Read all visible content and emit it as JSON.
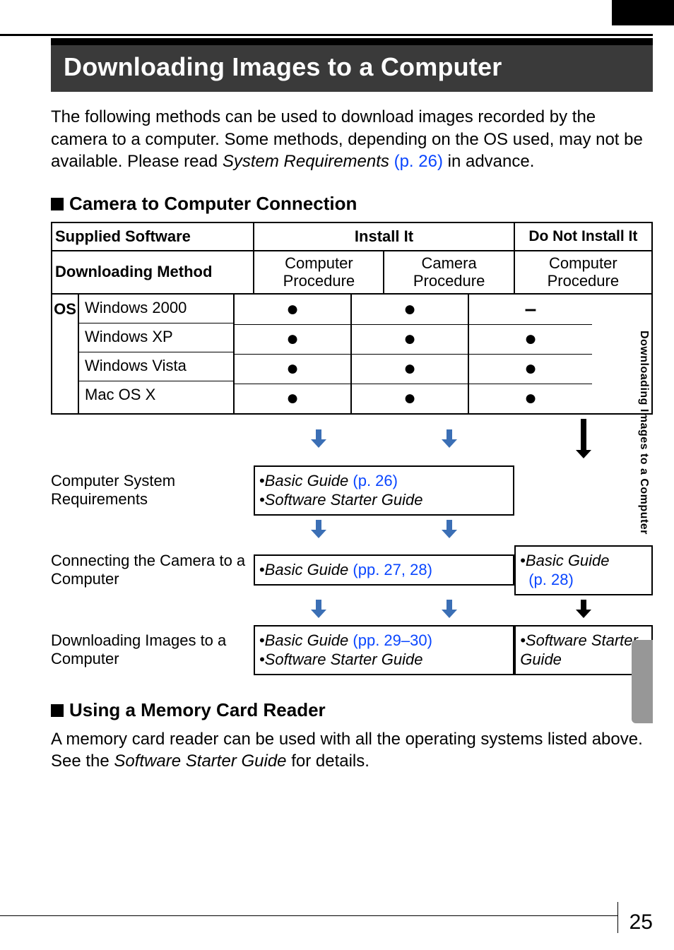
{
  "title": "Downloading Images to a Computer",
  "intro_part1": "The following methods can be used to download images recorded by the camera to a computer. Some methods, depending on the OS used, may not be available. Please read ",
  "intro_sys_req": "System Requirements",
  "intro_pref": " (p. 26)",
  "intro_part2": " in advance.",
  "section1": "Camera to Computer Connection",
  "tbl": {
    "supplied": "Supplied Software",
    "install": "Install It",
    "noinstall": "Do Not Install It",
    "dlmethod": "Downloading Method",
    "comp_proc": "Computer Procedure",
    "cam_proc": "Camera Procedure",
    "comp_proc2": "Computer Procedure",
    "os_label": "OS",
    "os": [
      "Windows 2000",
      "Windows XP",
      "Windows Vista",
      "Mac OS X"
    ],
    "col_comp": [
      "●",
      "●",
      "●",
      "●"
    ],
    "col_cam": [
      "●",
      "●",
      "●",
      "●"
    ],
    "col_no": [
      "–",
      "●",
      "●",
      "●"
    ]
  },
  "flow": {
    "row1_label": "Computer System Requirements",
    "row1_box_l1_pre": "•",
    "row1_box_l1_ital": "Basic Guide",
    "row1_box_l1_link": " (p. 26)",
    "row1_box_l2": "•Software Starter Guide",
    "row2_label": "Connecting the Camera to a Computer",
    "row2_box_mid_pre": "•",
    "row2_box_mid_ital": "Basic Guide",
    "row2_box_mid_link": " (pp. 27, 28)",
    "row2_box_right_pre": "•",
    "row2_box_right_ital": "Basic Guide",
    "row2_box_right_link": "(p. 28)",
    "row3_label": "Downloading Images to a Computer",
    "row3_box_mid_l1_pre": "•",
    "row3_box_mid_l1_ital": "Basic Guide",
    "row3_box_mid_l1_link": " (pp. 29–30)",
    "row3_box_mid_l2": "•Software Starter Guide",
    "row3_box_right": "•Software Starter Guide"
  },
  "section2": "Using a Memory Card Reader",
  "body2_part1": "A memory card reader can be used with all the operating systems listed above. See the ",
  "body2_ital": "Software Starter Guide",
  "body2_part2": " for details.",
  "side_label": "Downloading Images to a Computer",
  "page_number": "25"
}
